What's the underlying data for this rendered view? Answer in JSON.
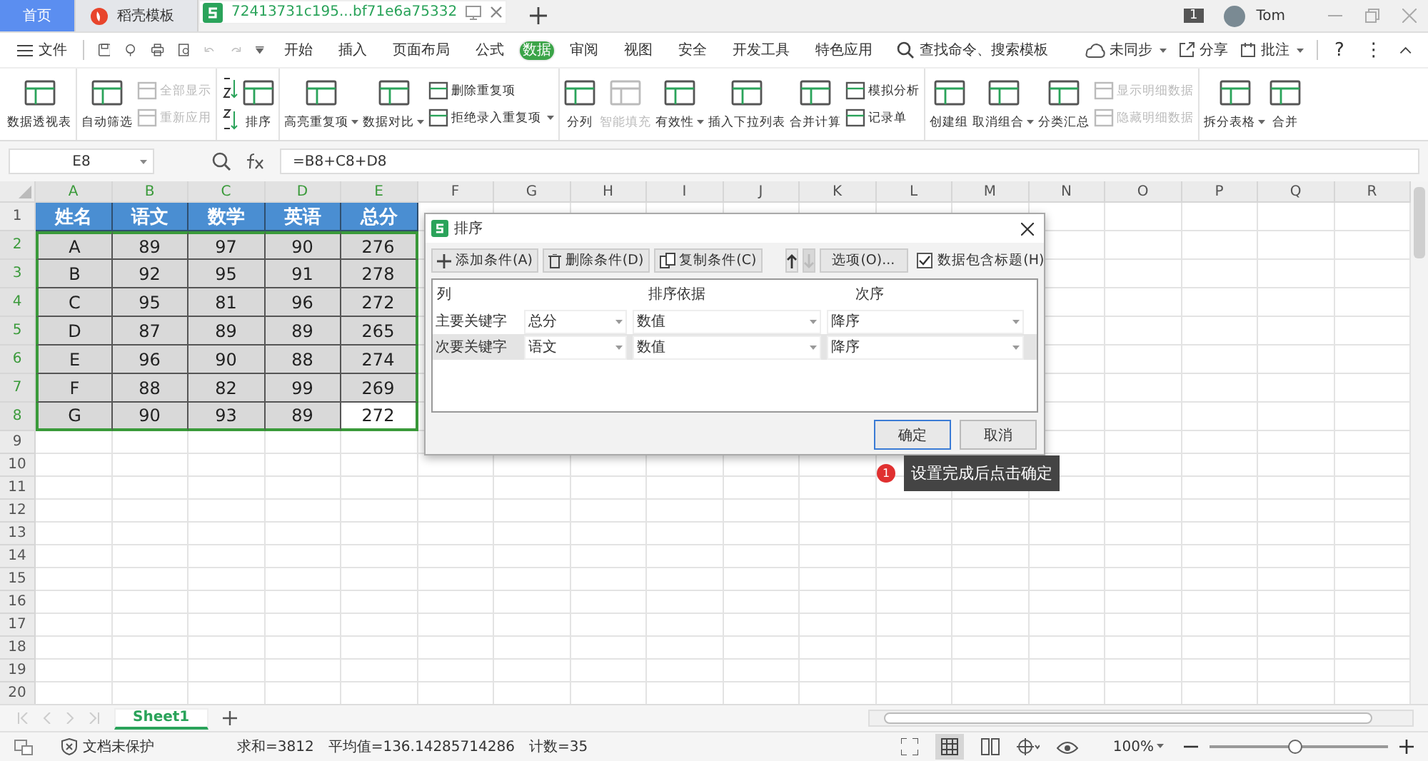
{
  "title_tabs": [
    {
      "label": "首页",
      "kind": "home",
      "selected": false
    },
    {
      "label": "稻壳模板",
      "kind": "template",
      "selected": false
    },
    {
      "label": "72413731c195...bf71e6a75332",
      "kind": "document",
      "selected": true
    }
  ],
  "account": {
    "badge": "1",
    "user": "Tom"
  },
  "menu": {
    "file": "文件",
    "tabs": [
      {
        "label": "开始",
        "selected": false
      },
      {
        "label": "插入",
        "selected": false
      },
      {
        "label": "页面布局",
        "selected": false
      },
      {
        "label": "公式",
        "selected": false
      },
      {
        "label": "数据",
        "selected": true
      },
      {
        "label": "审阅",
        "selected": false
      },
      {
        "label": "视图",
        "selected": false
      },
      {
        "label": "安全",
        "selected": false
      },
      {
        "label": "开发工具",
        "selected": false
      },
      {
        "label": "特色应用",
        "selected": false
      }
    ],
    "search": {
      "placeholder": "查找命令、搜索模板"
    },
    "sync": "未同步",
    "share": "分享",
    "comment": "批注",
    "help": "?",
    "more": "⋮"
  },
  "ribbon": [
    {
      "items": [
        {
          "kind": "large",
          "label": "数据透视表",
          "disabled": false,
          "dropdown": false
        }
      ]
    },
    {
      "items": [
        {
          "kind": "large",
          "label": "自动筛选",
          "disabled": false,
          "dropdown": false
        },
        {
          "kind": "stack",
          "items": [
            {
              "label": "全部显示",
              "disabled": true,
              "dropdown": false
            },
            {
              "label": "重新应用",
              "disabled": true,
              "dropdown": false
            }
          ]
        }
      ]
    },
    {
      "items": [
        {
          "kind": "sort-icons"
        },
        {
          "kind": "large",
          "label": "排序",
          "disabled": false,
          "dropdown": false
        }
      ]
    },
    {
      "items": [
        {
          "kind": "large",
          "label": "高亮重复项",
          "disabled": false,
          "dropdown": true
        },
        {
          "kind": "large",
          "label": "数据对比",
          "disabled": false,
          "dropdown": true
        },
        {
          "kind": "stack",
          "items": [
            {
              "label": "删除重复项",
              "disabled": false,
              "dropdown": false
            },
            {
              "label": "拒绝录入重复项",
              "disabled": false,
              "dropdown": true
            }
          ]
        }
      ]
    },
    {
      "items": [
        {
          "kind": "large",
          "label": "分列",
          "disabled": false,
          "dropdown": false
        },
        {
          "kind": "large",
          "label": "智能填充",
          "disabled": true,
          "dropdown": false
        },
        {
          "kind": "large",
          "label": "有效性",
          "disabled": false,
          "dropdown": true
        },
        {
          "kind": "large",
          "label": "插入下拉列表",
          "disabled": false,
          "dropdown": false
        },
        {
          "kind": "large",
          "label": "合并计算",
          "disabled": false,
          "dropdown": false
        },
        {
          "kind": "stack",
          "items": [
            {
              "label": "模拟分析",
              "disabled": false,
              "dropdown": false
            },
            {
              "label": "记录单",
              "disabled": false,
              "dropdown": false
            }
          ]
        }
      ]
    },
    {
      "items": [
        {
          "kind": "large",
          "label": "创建组",
          "disabled": false,
          "dropdown": false
        },
        {
          "kind": "large",
          "label": "取消组合",
          "disabled": false,
          "dropdown": true
        },
        {
          "kind": "large",
          "label": "分类汇总",
          "disabled": false,
          "dropdown": false
        },
        {
          "kind": "stack",
          "items": [
            {
              "label": "显示明细数据",
              "disabled": true,
              "dropdown": false
            },
            {
              "label": "隐藏明细数据",
              "disabled": true,
              "dropdown": false
            }
          ]
        }
      ]
    },
    {
      "items": [
        {
          "kind": "large",
          "label": "拆分表格",
          "disabled": false,
          "dropdown": true
        },
        {
          "kind": "large",
          "label": "合并",
          "disabled": false,
          "dropdown": false
        }
      ]
    }
  ],
  "formula_bar": {
    "cell_ref": "E8",
    "formula": "=B8+C8+D8"
  },
  "sheet": {
    "columns": [
      {
        "label": "A",
        "selected": true
      },
      {
        "label": "B",
        "selected": true
      },
      {
        "label": "C",
        "selected": true
      },
      {
        "label": "D",
        "selected": true
      },
      {
        "label": "E",
        "selected": true
      },
      {
        "label": "F",
        "selected": false
      },
      {
        "label": "G",
        "selected": false
      },
      {
        "label": "H",
        "selected": false
      },
      {
        "label": "I",
        "selected": false
      },
      {
        "label": "J",
        "selected": false
      },
      {
        "label": "K",
        "selected": false
      },
      {
        "label": "L",
        "selected": false
      },
      {
        "label": "M",
        "selected": false
      },
      {
        "label": "N",
        "selected": false
      },
      {
        "label": "O",
        "selected": false
      },
      {
        "label": "P",
        "selected": false
      },
      {
        "label": "Q",
        "selected": false
      },
      {
        "label": "R",
        "selected": false
      }
    ],
    "row_numbers": [
      {
        "label": "1",
        "selected": false
      },
      {
        "label": "2",
        "selected": true
      },
      {
        "label": "3",
        "selected": true
      },
      {
        "label": "4",
        "selected": true
      },
      {
        "label": "5",
        "selected": true
      },
      {
        "label": "6",
        "selected": true
      },
      {
        "label": "7",
        "selected": true
      },
      {
        "label": "8",
        "selected": true
      },
      {
        "label": "9",
        "selected": false
      },
      {
        "label": "10",
        "selected": false
      },
      {
        "label": "11",
        "selected": false
      },
      {
        "label": "12",
        "selected": false
      },
      {
        "label": "13",
        "selected": false
      },
      {
        "label": "14",
        "selected": false
      },
      {
        "label": "15",
        "selected": false
      },
      {
        "label": "16",
        "selected": false
      },
      {
        "label": "17",
        "selected": false
      },
      {
        "label": "18",
        "selected": false
      },
      {
        "label": "19",
        "selected": false
      },
      {
        "label": "20",
        "selected": false
      }
    ],
    "header": [
      "姓名",
      "语文",
      "数学",
      "英语",
      "总分"
    ],
    "rows": [
      [
        {
          "text": "A",
          "active": false
        },
        {
          "text": "89",
          "active": false
        },
        {
          "text": "97",
          "active": false
        },
        {
          "text": "90",
          "active": false
        },
        {
          "text": "276",
          "active": false
        }
      ],
      [
        {
          "text": "B",
          "active": false
        },
        {
          "text": "92",
          "active": false
        },
        {
          "text": "95",
          "active": false
        },
        {
          "text": "91",
          "active": false
        },
        {
          "text": "278",
          "active": false
        }
      ],
      [
        {
          "text": "C",
          "active": false
        },
        {
          "text": "95",
          "active": false
        },
        {
          "text": "81",
          "active": false
        },
        {
          "text": "96",
          "active": false
        },
        {
          "text": "272",
          "active": false
        }
      ],
      [
        {
          "text": "D",
          "active": false
        },
        {
          "text": "87",
          "active": false
        },
        {
          "text": "89",
          "active": false
        },
        {
          "text": "89",
          "active": false
        },
        {
          "text": "265",
          "active": false
        }
      ],
      [
        {
          "text": "E",
          "active": false
        },
        {
          "text": "96",
          "active": false
        },
        {
          "text": "90",
          "active": false
        },
        {
          "text": "88",
          "active": false
        },
        {
          "text": "274",
          "active": false
        }
      ],
      [
        {
          "text": "F",
          "active": false
        },
        {
          "text": "88",
          "active": false
        },
        {
          "text": "82",
          "active": false
        },
        {
          "text": "99",
          "active": false
        },
        {
          "text": "269",
          "active": false
        }
      ],
      [
        {
          "text": "G",
          "active": false
        },
        {
          "text": "90",
          "active": false
        },
        {
          "text": "93",
          "active": false
        },
        {
          "text": "89",
          "active": false
        },
        {
          "text": "272",
          "active": true
        }
      ]
    ]
  },
  "dialog": {
    "title": "排序",
    "toolbar": [
      {
        "label": "添加条件(A)",
        "kind": "add"
      },
      {
        "label": "删除条件(D)",
        "kind": "delete"
      },
      {
        "label": "复制条件(C)",
        "kind": "copy"
      }
    ],
    "move_up_disabled": false,
    "move_down_disabled": true,
    "options": "选项(O)...",
    "has_header": {
      "label": "数据包含标题(H)",
      "checked": true
    },
    "columns": [
      "列",
      "排序依据",
      "次序"
    ],
    "rows": [
      {
        "label": "主要关键字",
        "column": "总分",
        "basis": "数值",
        "order": "降序",
        "selected": false
      },
      {
        "label": "次要关键字",
        "column": "语文",
        "basis": "数值",
        "order": "降序",
        "selected": true
      }
    ],
    "ok": "确定",
    "cancel": "取消"
  },
  "callout": {
    "number": "1",
    "text": "设置完成后点击确定"
  },
  "sheet_tabs": [
    {
      "label": "Sheet1",
      "selected": true
    }
  ],
  "status_bar": {
    "protection": "文档未保护",
    "sum": "求和=3812",
    "average": "平均值=136.14285714286",
    "count": "计数=35",
    "zoom": "100%",
    "zoom_level": {
      "level": 0.48
    }
  }
}
